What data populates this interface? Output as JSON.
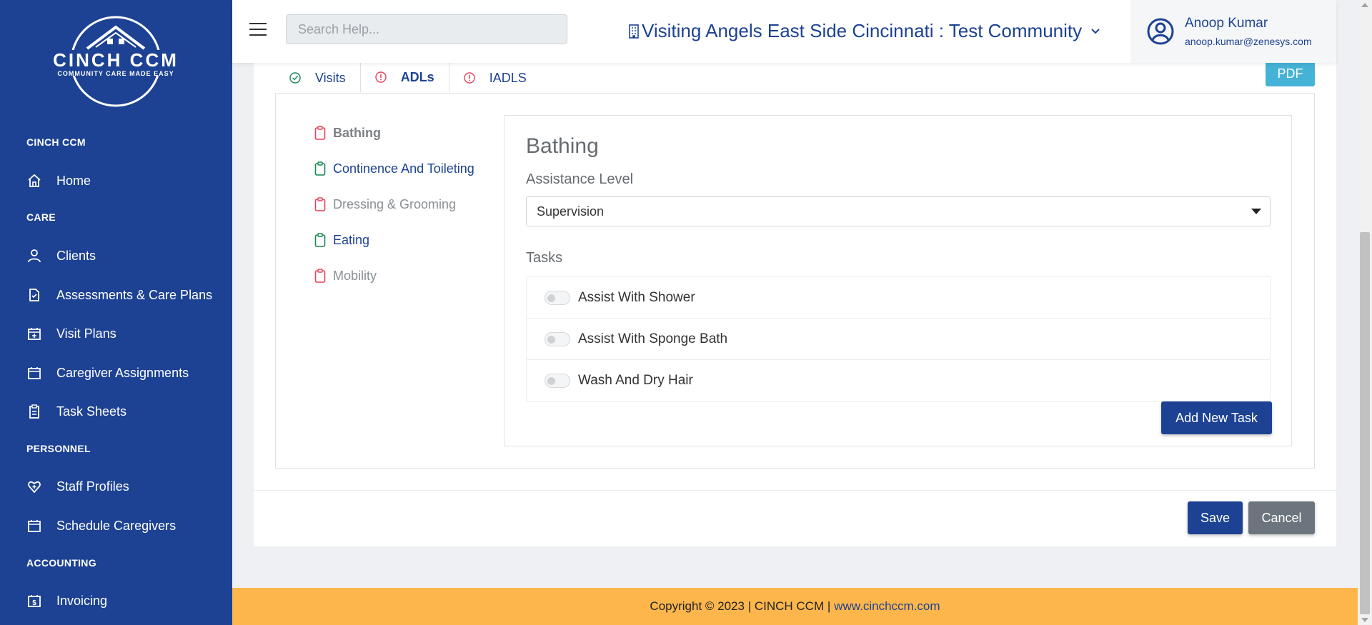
{
  "brand": {
    "logo_name": "CINCH CCM",
    "logo_tagline": "COMMUNITY CARE MADE EASY"
  },
  "sidebar": {
    "sections": [
      {
        "title": "CINCH CCM",
        "items": [
          {
            "label": "Home",
            "icon": "home-icon"
          }
        ]
      },
      {
        "title": "CARE",
        "items": [
          {
            "label": "Clients",
            "icon": "user-icon"
          },
          {
            "label": "Assessments & Care Plans",
            "icon": "document-icon"
          },
          {
            "label": "Visit Plans",
            "icon": "calendar-plus-icon"
          },
          {
            "label": "Caregiver Assignments",
            "icon": "calendar-icon"
          },
          {
            "label": "Task Sheets",
            "icon": "clipboard-icon"
          }
        ]
      },
      {
        "title": "PERSONNEL",
        "items": [
          {
            "label": "Staff Profiles",
            "icon": "heart-icon"
          },
          {
            "label": "Schedule Caregivers",
            "icon": "calendar-icon"
          }
        ]
      },
      {
        "title": "ACCOUNTING",
        "items": [
          {
            "label": "Invoicing",
            "icon": "invoice-icon"
          }
        ]
      }
    ]
  },
  "header": {
    "search_placeholder": "Search Help...",
    "community": "Visiting Angels East Side Cincinnati : Test Community",
    "user_name": "Anoop Kumar",
    "user_email": "anoop.kumar@zenesys.com"
  },
  "tabs": [
    {
      "label": "Visits",
      "status": "complete"
    },
    {
      "label": "ADLs",
      "status": "incomplete",
      "active": true
    },
    {
      "label": "IADLS",
      "status": "incomplete"
    }
  ],
  "pdf_label": "PDF",
  "adl_items": [
    {
      "label": "Bathing",
      "status": "red",
      "active": true
    },
    {
      "label": "Continence And Toileting",
      "status": "green"
    },
    {
      "label": "Dressing & Grooming",
      "status": "red"
    },
    {
      "label": "Eating",
      "status": "green"
    },
    {
      "label": "Mobility",
      "status": "red"
    }
  ],
  "detail": {
    "title": "Bathing",
    "assistance_level_label": "Assistance Level",
    "assistance_level_value": "Supervision",
    "tasks_label": "Tasks",
    "tasks": [
      {
        "name": "Assist With Shower",
        "enabled": false
      },
      {
        "name": "Assist With Sponge Bath",
        "enabled": false
      },
      {
        "name": "Wash And Dry Hair",
        "enabled": false
      }
    ],
    "add_task_label": "Add New Task"
  },
  "actions": {
    "save_label": "Save",
    "cancel_label": "Cancel"
  },
  "footer": {
    "text": "Copyright © 2023 | CINCH CCM |",
    "link": "www.cinchccm.com"
  },
  "colors": {
    "primary": "#1d4293",
    "footer_bg": "#fdb64c",
    "pdf_bg": "#45b3d6",
    "status_red": "#e8425c",
    "status_green": "#198754"
  }
}
